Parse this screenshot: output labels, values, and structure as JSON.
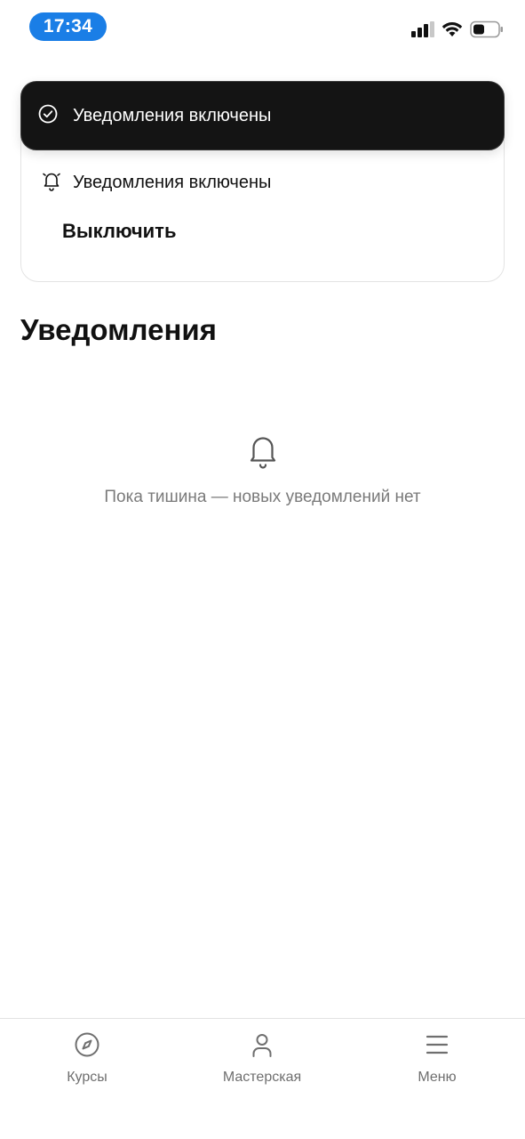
{
  "status_bar": {
    "time": "17:34",
    "icons": [
      "cellular-signal-icon",
      "wifi-icon",
      "battery-icon"
    ]
  },
  "toast": {
    "icon": "check-circle-icon",
    "text": "Уведомления включены"
  },
  "notifications_card": {
    "icon": "bell-ringing-icon",
    "status_text": "Уведомления включены",
    "disable_button_label": "Выключить"
  },
  "page": {
    "title": "Уведомления"
  },
  "empty_state": {
    "icon": "bell-icon",
    "text": "Пока тишина — новых уведомлений нет"
  },
  "bottom_nav": {
    "items": [
      {
        "label": "Курсы",
        "icon": "compass-icon"
      },
      {
        "label": "Мастерская",
        "icon": "user-icon"
      },
      {
        "label": "Меню",
        "icon": "hamburger-menu-icon"
      }
    ]
  },
  "colors": {
    "time_pill": "#1a7ee6",
    "toast_background": "#141414",
    "muted_text": "#7a7a7a"
  }
}
